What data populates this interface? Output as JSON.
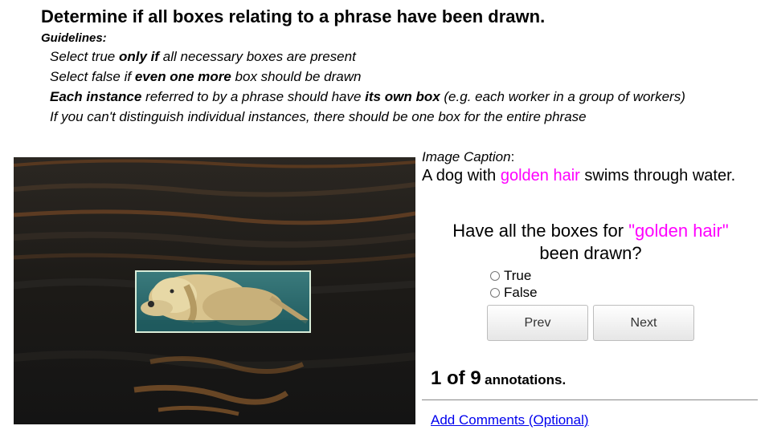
{
  "title": "Determine if all boxes relating to a phrase have been drawn.",
  "guidelines": {
    "heading": "Guidelines:",
    "line1": {
      "pre": "Select true ",
      "bold": "only if",
      "post": " all necessary boxes are present"
    },
    "line2": {
      "pre": "Select false if ",
      "bold": "even one more",
      "post": " box should be drawn"
    },
    "line3": {
      "bold1": "Each instance",
      "mid": " referred to by a phrase should have ",
      "bold2": "its own box",
      "post": " (e.g. each worker in a group of workers)"
    },
    "line4": "If you can't distinguish individual instances, there should be one box for the entire phrase"
  },
  "caption": {
    "label": "Image Caption",
    "label_suffix": ":",
    "pre": "A dog with ",
    "phrase": "golden hair",
    "post": " swims through water."
  },
  "question": {
    "pre": "Have all the boxes for ",
    "phrase": "\"golden hair\"",
    "post": " been drawn?"
  },
  "options": {
    "true_label": "True",
    "false_label": "False"
  },
  "buttons": {
    "prev": "Prev",
    "next": "Next"
  },
  "progress": {
    "count": "1 of 9",
    "suffix": "annotations."
  },
  "comments_link": "Add Comments (Optional)",
  "colors": {
    "phrase": "#ff00ff",
    "bbox": "#d8ecd8",
    "link": "#0000ee"
  }
}
